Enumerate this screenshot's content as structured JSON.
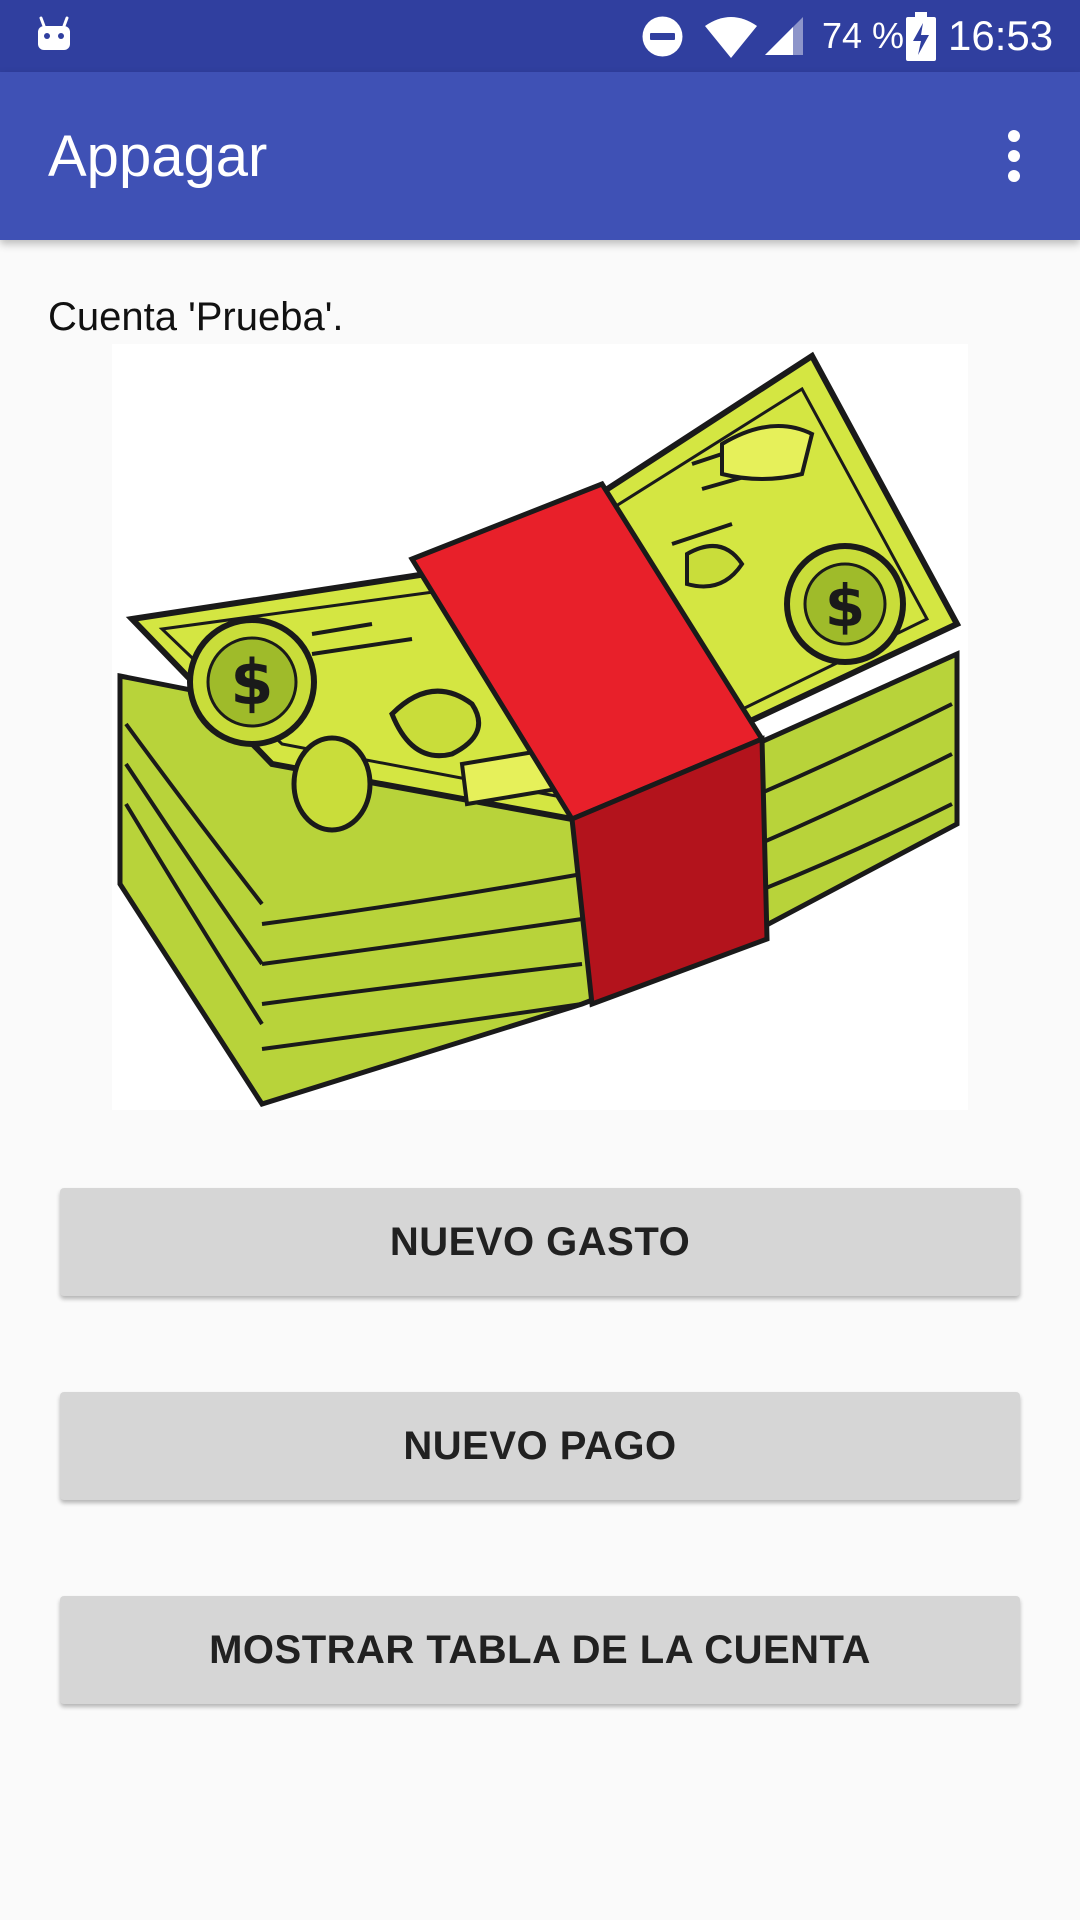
{
  "status_bar": {
    "battery_percent": "74 %",
    "time": "16:53",
    "icons": [
      "android-notification-icon",
      "do-not-disturb-icon",
      "wifi-icon",
      "cell-signal-icon",
      "battery-charging-icon"
    ]
  },
  "app_bar": {
    "title": "Appagar",
    "overflow_icon": "more-vert-icon"
  },
  "main": {
    "account_text": "Cuenta 'Prueba'.",
    "image": "money-stack-illustration",
    "buttons": [
      {
        "label": "NUEVO GASTO"
      },
      {
        "label": "NUEVO PAGO"
      },
      {
        "label": "MOSTRAR TABLA DE LA CUENTA"
      }
    ]
  },
  "colors": {
    "status_bar": "#303f9f",
    "app_bar": "#3f51b5",
    "button": "#d6d6d6",
    "background": "#fafafa",
    "bill_green": "#c5dc3b",
    "band_red": "#e8202a"
  }
}
